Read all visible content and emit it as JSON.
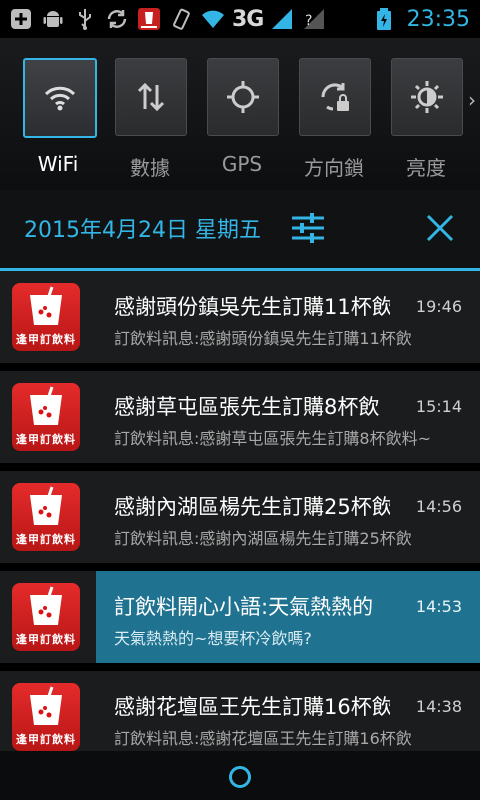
{
  "status_bar": {
    "icons": [
      "add-icon",
      "android-icon",
      "usb-icon",
      "sync-icon",
      "app-notification-icon",
      "vibrate-icon",
      "wifi-icon",
      "signal-icon",
      "no-sim-icon",
      "battery-icon"
    ],
    "network_label": "3G",
    "time": "23:35",
    "accent": "#33b5e5"
  },
  "quick_settings": [
    {
      "label": "WiFi",
      "icon": "wifi-icon",
      "active": true
    },
    {
      "label": "數據",
      "icon": "data-transfer-icon",
      "active": false
    },
    {
      "label": "GPS",
      "icon": "gps-icon",
      "active": false
    },
    {
      "label": "方向鎖",
      "icon": "rotation-lock-icon",
      "active": false
    },
    {
      "label": "亮度",
      "icon": "brightness-icon",
      "active": false
    }
  ],
  "header": {
    "date": "2015年4月24日 星期五"
  },
  "notifications": [
    {
      "app_label": "逢甲訂飲料",
      "title": "感謝頭份鎮吳先生訂購11杯飲",
      "time": "19:46",
      "text": "訂飲料訊息:感謝頭份鎮吳先生訂購11杯飲",
      "highlight": false
    },
    {
      "app_label": "逢甲訂飲料",
      "title": "感謝草屯區張先生訂購8杯飲",
      "time": "15:14",
      "text": "訂飲料訊息:感謝草屯區張先生訂購8杯飲料~",
      "highlight": false
    },
    {
      "app_label": "逢甲訂飲料",
      "title": "感謝內湖區楊先生訂購25杯飲",
      "time": "14:56",
      "text": "訂飲料訊息:感謝內湖區楊先生訂購25杯飲",
      "highlight": false
    },
    {
      "app_label": "逢甲訂飲料",
      "title": "訂飲料開心小語:天氣熱熱的",
      "time": "14:53",
      "text": "天氣熱熱的~想要杯冷飲嗎?",
      "highlight": true
    },
    {
      "app_label": "逢甲訂飲料",
      "title": "感謝花壇區王先生訂購16杯飲",
      "time": "14:38",
      "text": "訂飲料訊息:感謝花壇區王先生訂購16杯飲",
      "highlight": false
    }
  ]
}
